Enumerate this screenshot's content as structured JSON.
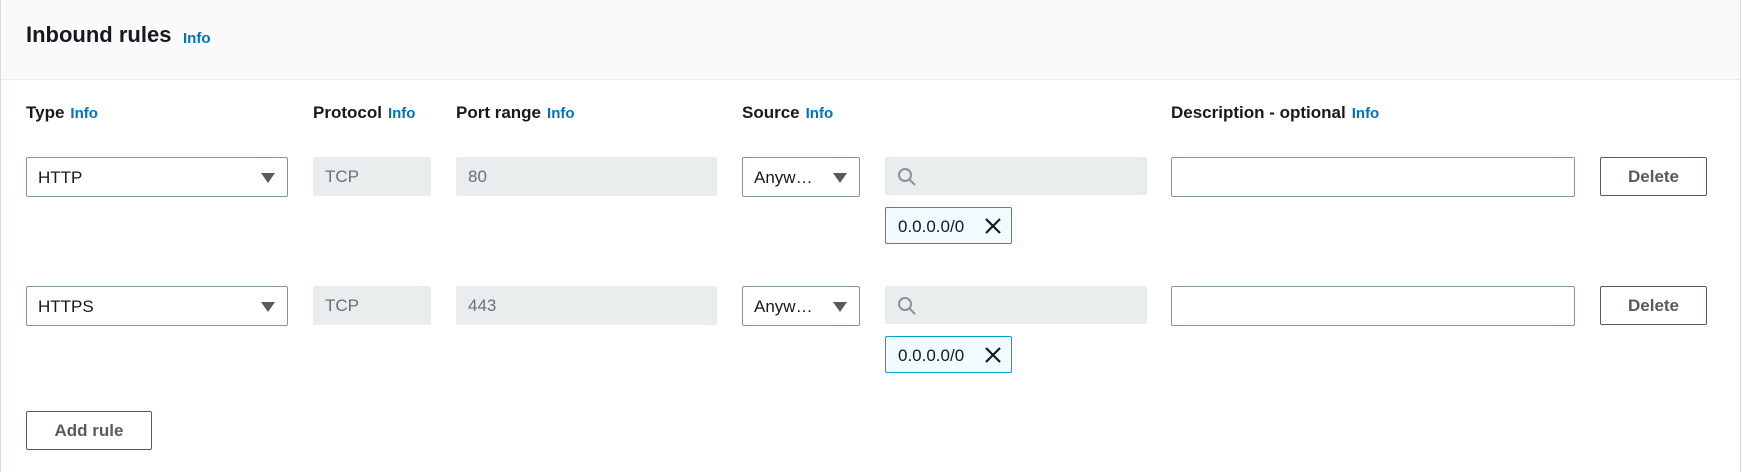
{
  "section": {
    "title": "Inbound rules",
    "info_label": "Info"
  },
  "columns": {
    "type": "Type",
    "protocol": "Protocol",
    "port_range": "Port range",
    "source": "Source",
    "description": "Description - optional",
    "info_label": "Info"
  },
  "rules": [
    {
      "type": "HTTP",
      "protocol": "TCP",
      "port_range": "80",
      "source": "Anyw…",
      "search_value": "",
      "cidr": "0.0.0.0/0",
      "description": "",
      "delete_label": "Delete"
    },
    {
      "type": "HTTPS",
      "protocol": "TCP",
      "port_range": "443",
      "source": "Anyw…",
      "search_value": "",
      "cidr": "0.0.0.0/0",
      "description": "",
      "delete_label": "Delete"
    }
  ],
  "add_rule_label": "Add rule",
  "colors": {
    "link": "#0073bb",
    "token_border": "#00a1c9",
    "token_bg": "#f1faff",
    "disabled_bg": "#eaeded"
  }
}
